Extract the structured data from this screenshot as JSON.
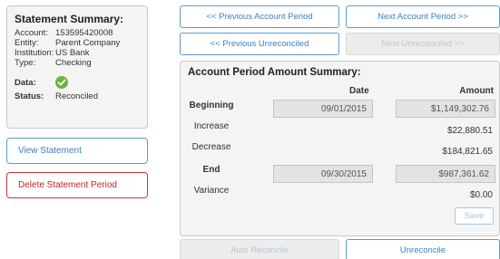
{
  "summary": {
    "title": "Statement Summary:",
    "account_label": "Account:",
    "account_value": "153595420008",
    "entity_label": "Entity:",
    "entity_value": "Parent Company",
    "institution_label": "Institution:",
    "institution_value": "US Bank",
    "type_label": "Type:",
    "type_value": "Checking",
    "data_label": "Data:",
    "status_label": "Status:",
    "status_value": "Reconciled"
  },
  "actions": {
    "view_statement": "View Statement",
    "delete_period": "Delete Statement Period"
  },
  "nav": {
    "prev_period": "<< Previous Account Period",
    "next_period": "Next Account Period >>",
    "prev_unreconciled": "<< Previous Unreconciled",
    "next_unreconciled": "Next Unreconciled >>"
  },
  "period": {
    "title": "Account Period Amount Summary:",
    "date_header": "Date",
    "amount_header": "Amount",
    "beginning_label": "Beginning",
    "beginning_date": "09/01/2015",
    "beginning_amount": "$1,149,302.76",
    "increase_label": "Increase",
    "increase_amount": "$22,880.51",
    "decrease_label": "Decrease",
    "decrease_amount": "$184,821.65",
    "end_label": "End",
    "end_date": "09/30/2015",
    "end_amount": "$987,361.62",
    "variance_label": "Variance",
    "variance_amount": "$0.00",
    "save_label": "Save"
  },
  "bottom": {
    "auto_reconcile": "Auto Reconcile",
    "unreconcile": "Unreconcile"
  },
  "colors": {
    "accent_blue": "#3a7fc4",
    "danger_red": "#c4222c",
    "success_green": "#6fb33b"
  },
  "icons": {
    "data_status": "check-circle-icon"
  }
}
